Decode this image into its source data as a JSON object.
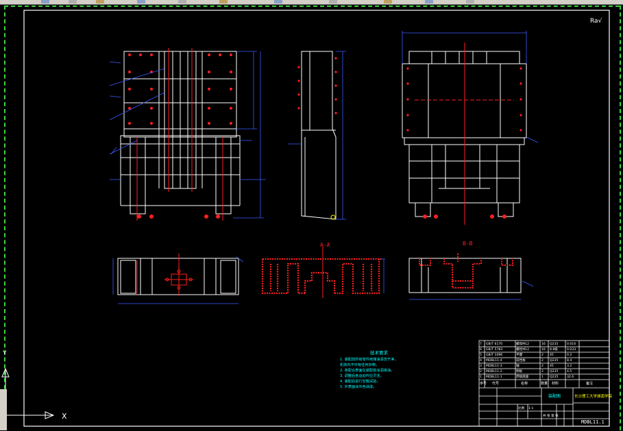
{
  "title_block": {
    "parts": [
      {
        "no": "7",
        "code": "GB/T 6170",
        "name": "螺母M12",
        "qty": "16",
        "mat": "Q235",
        "note": "0.016"
      },
      {
        "no": "6",
        "code": "GB/T 5783",
        "name": "螺栓M12",
        "qty": "16",
        "mat": "8.8级",
        "note": "0.033"
      },
      {
        "no": "5",
        "code": "GB/T 1096",
        "name": "平键",
        "qty": "2",
        "mat": "45",
        "note": "0.2"
      },
      {
        "no": "4",
        "code": "MDBL11-4",
        "name": "前挡板",
        "qty": "2",
        "mat": "Q235",
        "note": "8.4"
      },
      {
        "no": "3",
        "code": "MDBL11-3",
        "name": "轴",
        "qty": "2",
        "mat": "45",
        "note": "3.2"
      },
      {
        "no": "2",
        "code": "MDBL11-2",
        "name": "侧板",
        "qty": "2",
        "mat": "Q235",
        "note": "4.5"
      },
      {
        "no": "1",
        "code": "MDBL11-1",
        "name": "焊接底座",
        "qty": "1",
        "mat": "Q235",
        "note": "32.6"
      }
    ],
    "header_cols": [
      "序号",
      "代号",
      "名称",
      "数量",
      "材料",
      "备注"
    ],
    "drawing_name": "装配图",
    "school": "长沙理工大学城南学院",
    "drawing_no": "MDBL11.1",
    "scale_label": "比例",
    "scale_value": "1:1",
    "sheet_label": "共 张 第 张"
  },
  "notes": {
    "title": "技术要求",
    "lines": [
      "1. 装配前所有零件用煤油清洗干净，",
      "机体内不许有任何杂物，",
      "2. 各配合表面在装配前涂润滑油，",
      "3. 调整后各运动件应灵活，",
      "4. 装配后进行空载试验，",
      "5. 外表面涂灰色油漆。"
    ]
  },
  "labels": {
    "section_top_mid": "A-A",
    "section_top_right": "B-B",
    "corner_mark": "Ra√"
  },
  "ucs": {
    "x_label": "X",
    "y_label": "Y"
  },
  "colors": {
    "bg": "#000000",
    "frame": "#ffffff",
    "blue": "#3a5cff",
    "red": "#ff2020",
    "cyan": "#00ffff",
    "green": "#3fd23f",
    "yellow": "#ffff00"
  }
}
